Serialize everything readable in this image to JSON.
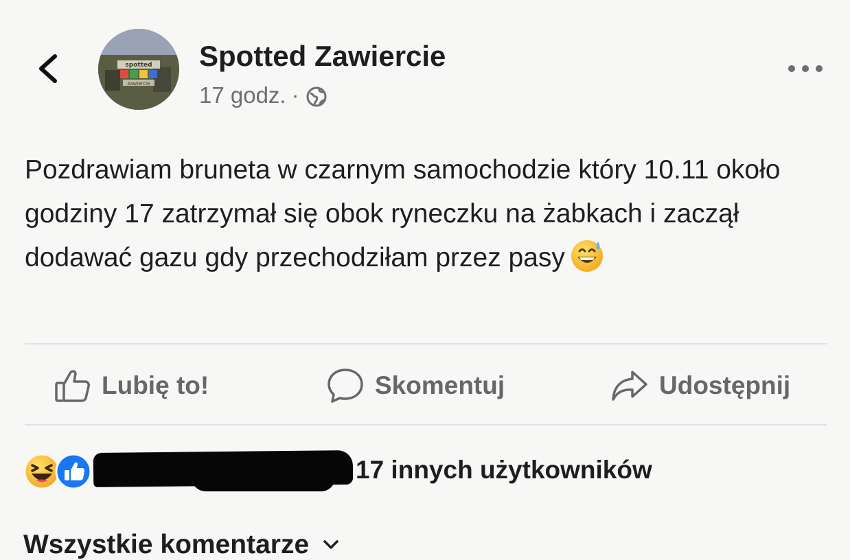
{
  "header": {
    "page_name": "Spotted Zawiercie",
    "timestamp": "17 godz.",
    "separator": "·",
    "audience_icon": "globe-icon",
    "back_icon": "chevron-left-icon",
    "more_icon": "ellipsis-icon",
    "avatar_text_1": "spotted",
    "avatar_text_2": "zawiercie"
  },
  "post": {
    "text": "Pozdrawiam bruneta w czarnym samochodzie który 10.11 około godziny 17 zatrzymał się obok ryneczku na żabkach i zaczął dodawać gazu gdy przechodziłam przez pasy",
    "emoji_icon": "grinning-sweat-emoji"
  },
  "actions": {
    "like_label": "Lubię to!",
    "comment_label": "Skomentuj",
    "share_label": "Udostępnij"
  },
  "reactions": {
    "icons": [
      "haha-reaction-icon",
      "like-reaction-icon"
    ],
    "summary": "17 innych użytkowników",
    "visible_fragment": "i"
  },
  "comments": {
    "filter_label": "Wszystkie komentarze"
  },
  "colors": {
    "background": "#f7f7f6",
    "text": "#1c1e21",
    "secondary_text": "#65676b",
    "like_blue": "#1877f2",
    "reaction_yellow": "#f7c548",
    "divider": "#dfe1e4"
  }
}
